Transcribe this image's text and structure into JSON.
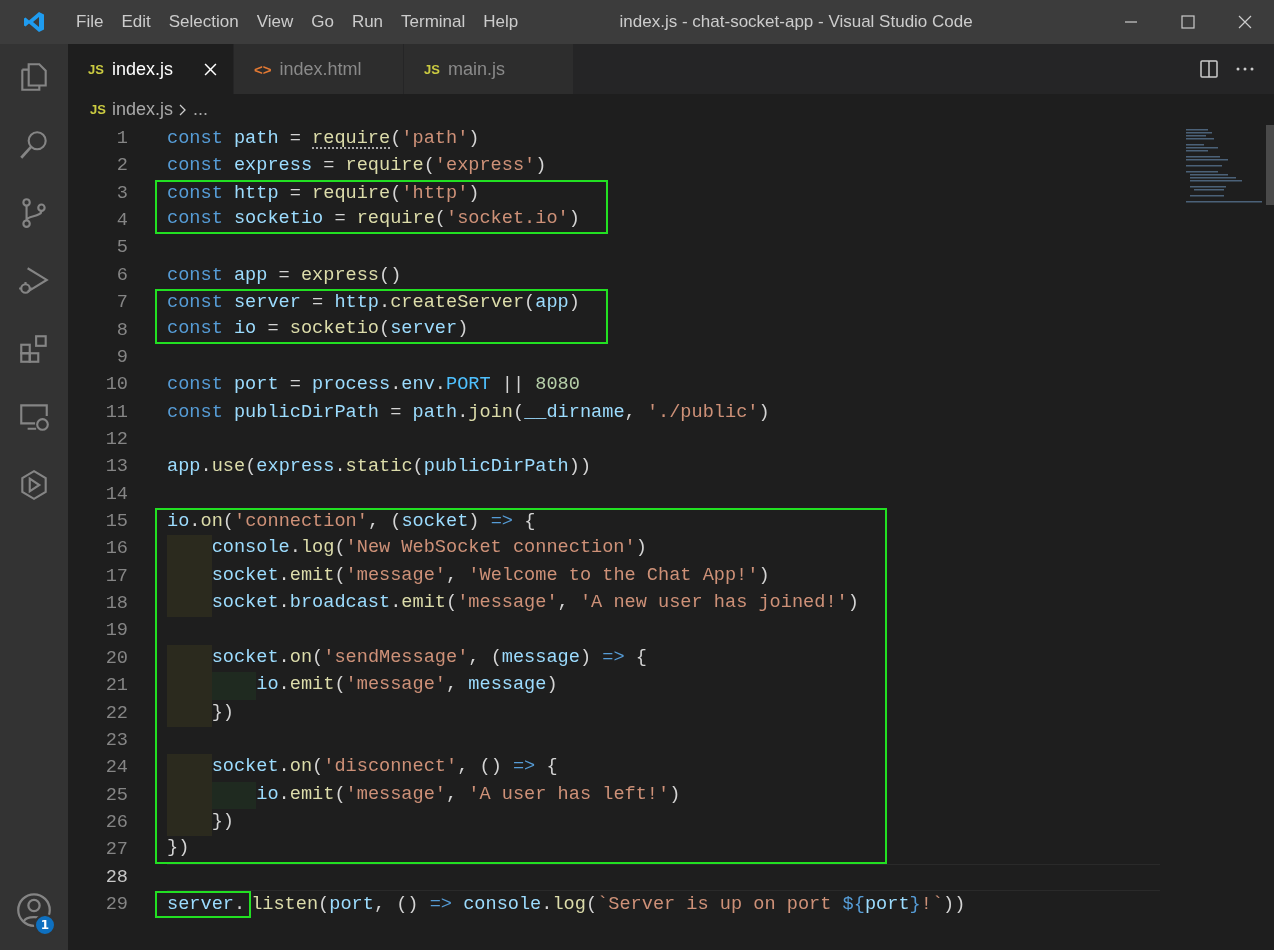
{
  "window": {
    "title": "index.js - chat-socket-app - Visual Studio Code"
  },
  "menu": [
    "File",
    "Edit",
    "Selection",
    "View",
    "Go",
    "Run",
    "Terminal",
    "Help"
  ],
  "activity_bar": {
    "account_badge": "1"
  },
  "tabs": [
    {
      "icon_text": "JS",
      "kind": "js",
      "label": "index.js",
      "selected": true
    },
    {
      "icon_text": "<>",
      "kind": "html",
      "label": "index.html",
      "selected": false
    },
    {
      "icon_text": "JS",
      "kind": "js",
      "label": "main.js",
      "selected": false
    }
  ],
  "breadcrumb": {
    "icon_text": "JS",
    "file": "index.js",
    "more": "..."
  },
  "lines": [
    {
      "number": "1",
      "marked": false,
      "current": false,
      "tokens": [
        {
          "kind": "kw",
          "text": "const "
        },
        {
          "kind": "var",
          "text": "path"
        },
        {
          "kind": "plain",
          "text": " = "
        },
        {
          "kind": "fn",
          "text": "require",
          "hint": true
        },
        {
          "kind": "plain",
          "text": "("
        },
        {
          "kind": "str",
          "text": "'path'"
        },
        {
          "kind": "plain",
          "text": ")"
        }
      ]
    },
    {
      "number": "2",
      "marked": false,
      "current": false,
      "tokens": [
        {
          "kind": "kw",
          "text": "const "
        },
        {
          "kind": "var",
          "text": "express"
        },
        {
          "kind": "plain",
          "text": " = "
        },
        {
          "kind": "fn",
          "text": "require"
        },
        {
          "kind": "plain",
          "text": "("
        },
        {
          "kind": "str",
          "text": "'express'"
        },
        {
          "kind": "plain",
          "text": ")"
        }
      ]
    },
    {
      "number": "3",
      "marked": true,
      "current": false,
      "tokens": [
        {
          "kind": "kw",
          "text": "const "
        },
        {
          "kind": "var",
          "text": "http"
        },
        {
          "kind": "plain",
          "text": " = "
        },
        {
          "kind": "fn",
          "text": "require"
        },
        {
          "kind": "plain",
          "text": "("
        },
        {
          "kind": "str",
          "text": "'http'"
        },
        {
          "kind": "plain",
          "text": ")"
        }
      ]
    },
    {
      "number": "4",
      "marked": true,
      "current": false,
      "tokens": [
        {
          "kind": "kw",
          "text": "const "
        },
        {
          "kind": "var",
          "text": "socketio"
        },
        {
          "kind": "plain",
          "text": " = "
        },
        {
          "kind": "fn",
          "text": "require"
        },
        {
          "kind": "plain",
          "text": "("
        },
        {
          "kind": "str",
          "text": "'socket.io'"
        },
        {
          "kind": "plain",
          "text": ")"
        }
      ]
    },
    {
      "number": "5",
      "marked": false,
      "current": false
    },
    {
      "number": "6",
      "marked": false,
      "current": false,
      "tokens": [
        {
          "kind": "kw",
          "text": "const "
        },
        {
          "kind": "var",
          "text": "app"
        },
        {
          "kind": "plain",
          "text": " = "
        },
        {
          "kind": "fn",
          "text": "express"
        },
        {
          "kind": "plain",
          "text": "()"
        }
      ]
    },
    {
      "number": "7",
      "marked": true,
      "current": false,
      "tokens": [
        {
          "kind": "kw",
          "text": "const "
        },
        {
          "kind": "var",
          "text": "server"
        },
        {
          "kind": "plain",
          "text": " = "
        },
        {
          "kind": "var",
          "text": "http"
        },
        {
          "kind": "plain",
          "text": "."
        },
        {
          "kind": "fn",
          "text": "createServer"
        },
        {
          "kind": "plain",
          "text": "("
        },
        {
          "kind": "var",
          "text": "app"
        },
        {
          "kind": "plain",
          "text": ")"
        }
      ]
    },
    {
      "number": "8",
      "marked": true,
      "current": false,
      "tokens": [
        {
          "kind": "kw",
          "text": "const "
        },
        {
          "kind": "var",
          "text": "io"
        },
        {
          "kind": "plain",
          "text": " = "
        },
        {
          "kind": "fn",
          "text": "socketio"
        },
        {
          "kind": "plain",
          "text": "("
        },
        {
          "kind": "var",
          "text": "server"
        },
        {
          "kind": "plain",
          "text": ")"
        }
      ]
    },
    {
      "number": "9",
      "marked": false,
      "current": false
    },
    {
      "number": "10",
      "marked": false,
      "current": false,
      "tokens": [
        {
          "kind": "kw",
          "text": "const "
        },
        {
          "kind": "var",
          "text": "port"
        },
        {
          "kind": "plain",
          "text": " = "
        },
        {
          "kind": "var",
          "text": "process"
        },
        {
          "kind": "plain",
          "text": "."
        },
        {
          "kind": "var",
          "text": "env"
        },
        {
          "kind": "plain",
          "text": "."
        },
        {
          "kind": "const",
          "text": "PORT"
        },
        {
          "kind": "plain",
          "text": " || "
        },
        {
          "kind": "num",
          "text": "8080"
        }
      ]
    },
    {
      "number": "11",
      "marked": false,
      "current": false,
      "tokens": [
        {
          "kind": "kw",
          "text": "const "
        },
        {
          "kind": "var",
          "text": "publicDirPath"
        },
        {
          "kind": "plain",
          "text": " = "
        },
        {
          "kind": "var",
          "text": "path"
        },
        {
          "kind": "plain",
          "text": "."
        },
        {
          "kind": "fn",
          "text": "join"
        },
        {
          "kind": "plain",
          "text": "("
        },
        {
          "kind": "var",
          "text": "__dirname"
        },
        {
          "kind": "plain",
          "text": ", "
        },
        {
          "kind": "str",
          "text": "'./public'"
        },
        {
          "kind": "plain",
          "text": ")"
        }
      ]
    },
    {
      "number": "12",
      "marked": false,
      "current": false
    },
    {
      "number": "13",
      "marked": false,
      "current": false,
      "tokens": [
        {
          "kind": "var",
          "text": "app"
        },
        {
          "kind": "plain",
          "text": "."
        },
        {
          "kind": "fn",
          "text": "use"
        },
        {
          "kind": "plain",
          "text": "("
        },
        {
          "kind": "var",
          "text": "express"
        },
        {
          "kind": "plain",
          "text": "."
        },
        {
          "kind": "fn",
          "text": "static"
        },
        {
          "kind": "plain",
          "text": "("
        },
        {
          "kind": "var",
          "text": "publicDirPath"
        },
        {
          "kind": "plain",
          "text": "))"
        }
      ]
    },
    {
      "number": "14",
      "marked": false,
      "current": false
    },
    {
      "number": "15",
      "marked": true,
      "current": false,
      "tokens": [
        {
          "kind": "var",
          "text": "io"
        },
        {
          "kind": "plain",
          "text": "."
        },
        {
          "kind": "fn",
          "text": "on"
        },
        {
          "kind": "plain",
          "text": "("
        },
        {
          "kind": "str",
          "text": "'connection'"
        },
        {
          "kind": "plain",
          "text": ", ("
        },
        {
          "kind": "var",
          "text": "socket"
        },
        {
          "kind": "plain",
          "text": ") "
        },
        {
          "kind": "kw",
          "text": "=>"
        },
        {
          "kind": "plain",
          "text": " {"
        }
      ],
      "children": [
        {
          "number": "16",
          "marked": true,
          "current": false,
          "tokens": [
            {
              "kind": "var",
              "text": "console"
            },
            {
              "kind": "plain",
              "text": "."
            },
            {
              "kind": "fn",
              "text": "log"
            },
            {
              "kind": "plain",
              "text": "("
            },
            {
              "kind": "str",
              "text": "'New WebSocket connection'"
            },
            {
              "kind": "plain",
              "text": ")"
            }
          ]
        },
        {
          "number": "17",
          "marked": true,
          "current": false,
          "tokens": [
            {
              "kind": "var",
              "text": "socket"
            },
            {
              "kind": "plain",
              "text": "."
            },
            {
              "kind": "fn",
              "text": "emit"
            },
            {
              "kind": "plain",
              "text": "("
            },
            {
              "kind": "str",
              "text": "'message'"
            },
            {
              "kind": "plain",
              "text": ", "
            },
            {
              "kind": "str",
              "text": "'Welcome to the Chat App!'"
            },
            {
              "kind": "plain",
              "text": ")"
            }
          ]
        },
        {
          "number": "18",
          "marked": true,
          "current": false,
          "tokens": [
            {
              "kind": "var",
              "text": "socket"
            },
            {
              "kind": "plain",
              "text": "."
            },
            {
              "kind": "var",
              "text": "broadcast"
            },
            {
              "kind": "plain",
              "text": "."
            },
            {
              "kind": "fn",
              "text": "emit"
            },
            {
              "kind": "plain",
              "text": "("
            },
            {
              "kind": "str",
              "text": "'message'"
            },
            {
              "kind": "plain",
              "text": ", "
            },
            {
              "kind": "str",
              "text": "'A new user has joined!'"
            },
            {
              "kind": "plain",
              "text": ")"
            }
          ]
        },
        {
          "number": "19",
          "marked": true,
          "current": false
        },
        {
          "number": "20",
          "marked": true,
          "current": false,
          "tokens": [
            {
              "kind": "var",
              "text": "socket"
            },
            {
              "kind": "plain",
              "text": "."
            },
            {
              "kind": "fn",
              "text": "on"
            },
            {
              "kind": "plain",
              "text": "("
            },
            {
              "kind": "str",
              "text": "'sendMessage'"
            },
            {
              "kind": "plain",
              "text": ", ("
            },
            {
              "kind": "var",
              "text": "message"
            },
            {
              "kind": "plain",
              "text": ") "
            },
            {
              "kind": "kw",
              "text": "=>"
            },
            {
              "kind": "plain",
              "text": " {"
            }
          ],
          "children": [
            {
              "number": "21",
              "marked": true,
              "current": false,
              "tokens": [
                {
                  "kind": "var",
                  "text": "io"
                },
                {
                  "kind": "plain",
                  "text": "."
                },
                {
                  "kind": "fn",
                  "text": "emit"
                },
                {
                  "kind": "plain",
                  "text": "("
                },
                {
                  "kind": "str",
                  "text": "'message'"
                },
                {
                  "kind": "plain",
                  "text": ", "
                },
                {
                  "kind": "var",
                  "text": "message"
                },
                {
                  "kind": "plain",
                  "text": ")"
                }
              ]
            }
          ]
        },
        {
          "number": "22",
          "marked": true,
          "current": false,
          "tokens": [
            {
              "kind": "plain",
              "text": "})"
            }
          ]
        },
        {
          "number": "23",
          "marked": true,
          "current": false
        },
        {
          "number": "24",
          "marked": true,
          "current": false,
          "tokens": [
            {
              "kind": "var",
              "text": "socket"
            },
            {
              "kind": "plain",
              "text": "."
            },
            {
              "kind": "fn",
              "text": "on"
            },
            {
              "kind": "plain",
              "text": "("
            },
            {
              "kind": "str",
              "text": "'disconnect'"
            },
            {
              "kind": "plain",
              "text": ", () "
            },
            {
              "kind": "kw",
              "text": "=>"
            },
            {
              "kind": "plain",
              "text": " {"
            }
          ],
          "children": [
            {
              "number": "25",
              "marked": true,
              "current": false,
              "tokens": [
                {
                  "kind": "var",
                  "text": "io"
                },
                {
                  "kind": "plain",
                  "text": "."
                },
                {
                  "kind": "fn",
                  "text": "emit"
                },
                {
                  "kind": "plain",
                  "text": "("
                },
                {
                  "kind": "str",
                  "text": "'message'"
                },
                {
                  "kind": "plain",
                  "text": ", "
                },
                {
                  "kind": "str",
                  "text": "'A user has left!'"
                },
                {
                  "kind": "plain",
                  "text": ")"
                }
              ]
            }
          ]
        },
        {
          "number": "26",
          "marked": true,
          "current": false,
          "tokens": [
            {
              "kind": "plain",
              "text": "})"
            }
          ]
        }
      ]
    },
    {
      "number": "27",
      "marked": true,
      "current": false,
      "tokens": [
        {
          "kind": "plain",
          "text": "})"
        }
      ]
    },
    {
      "number": "28",
      "marked": false,
      "current": true
    },
    {
      "number": "29",
      "marked": false,
      "current": false,
      "tokens": [
        {
          "kind": "var",
          "text": "server",
          "marked": true
        },
        {
          "kind": "plain",
          "text": ".",
          "marked": true
        },
        {
          "kind": "fn",
          "text": "listen"
        },
        {
          "kind": "plain",
          "text": "("
        },
        {
          "kind": "var",
          "text": "port"
        },
        {
          "kind": "plain",
          "text": ", () "
        },
        {
          "kind": "kw",
          "text": "=> "
        },
        {
          "kind": "var",
          "text": "console"
        },
        {
          "kind": "plain",
          "text": "."
        },
        {
          "kind": "fn",
          "text": "log"
        },
        {
          "kind": "plain",
          "text": "("
        },
        {
          "kind": "str",
          "text": "`Server is up on port "
        },
        {
          "kind": "kw",
          "text": "${"
        },
        {
          "kind": "var",
          "text": "port"
        },
        {
          "kind": "kw",
          "text": "}"
        },
        {
          "kind": "str",
          "text": "!`"
        },
        {
          "kind": "plain",
          "text": "))"
        }
      ]
    }
  ]
}
